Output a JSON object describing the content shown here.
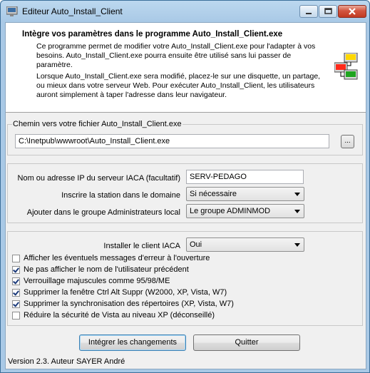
{
  "window": {
    "title": "Editeur Auto_Install_Client"
  },
  "header": {
    "title": "Intègre vos paramètres dans le programme Auto_Install_Client.exe",
    "para1": "Ce programme permet de modifier votre Auto_Install_Client.exe pour l'adapter à vos besoins. Auto_Install_Client.exe pourra ensuite être utilisé sans lui passer de paramètre.",
    "para2": "Lorsque Auto_Install_Client.exe sera modifié, placez-le sur une disquette, un partage, ou mieux dans votre serveur Web. Pour exécuter Auto_Install_Client, les utilisateurs auront simplement à taper l'adresse dans leur navigateur."
  },
  "path": {
    "label": "Chemin vers votre fichier Auto_Install_Client.exe",
    "value": "C:\\Inetpub\\wwwroot\\Auto_Install_Client.exe",
    "browse_label": "..."
  },
  "server": {
    "ip_label": "Nom ou adresse IP du serveur IACA (facultatif)",
    "ip_value": "SERV-PEDAGO",
    "domain_label": "Inscrire la station dans le domaine",
    "domain_value": "Si nécessaire",
    "admin_label": "Ajouter dans le groupe Administrateurs local",
    "admin_value": "Le groupe ADMINMOD"
  },
  "options": {
    "install_label": "Installer le client IACA",
    "install_value": "Oui",
    "checkboxes": [
      {
        "label": "Afficher les éventuels messages d'erreur à l'ouverture",
        "checked": false
      },
      {
        "label": "Ne pas afficher le nom de l'utilisateur précédent",
        "checked": true
      },
      {
        "label": "Verrouillage majuscules comme 95/98/ME",
        "checked": true
      },
      {
        "label": "Supprimer la fenêtre Ctrl Alt Suppr (W2000, XP, Vista, W7)",
        "checked": true
      },
      {
        "label": "Supprimer la synchronisation des répertoires (XP, Vista, W7)",
        "checked": true
      },
      {
        "label": "Réduire la sécurité de Vista au niveau XP (déconseillé)",
        "checked": false
      }
    ]
  },
  "buttons": {
    "apply_label": "Intégrer les changements",
    "quit_label": "Quitter"
  },
  "footer": {
    "version": "Version 2.3. Auteur SAYER André"
  }
}
